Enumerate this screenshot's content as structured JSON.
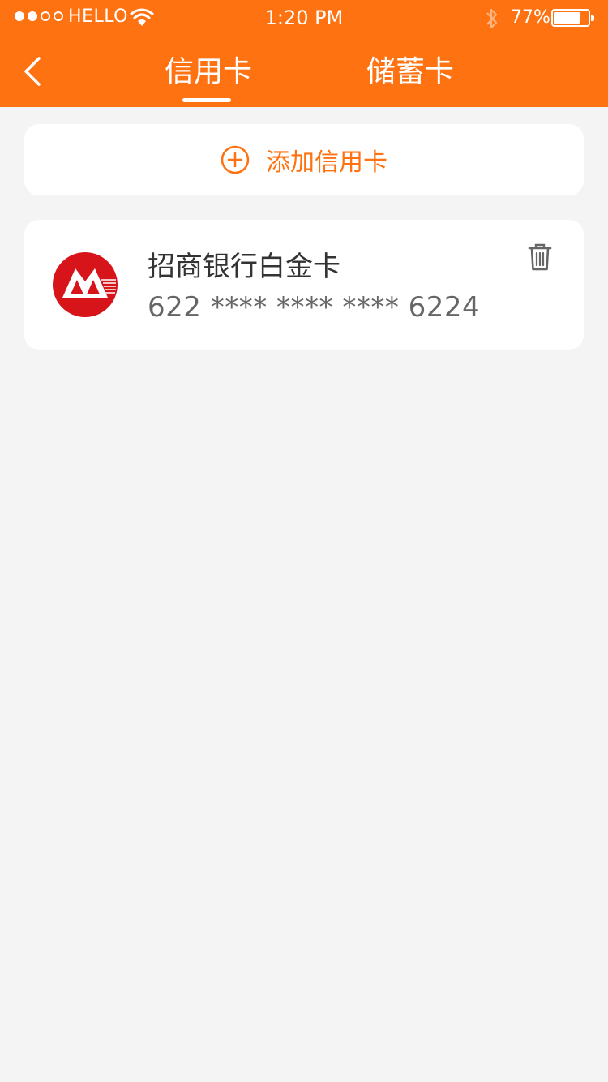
{
  "status_bar": {
    "carrier": "HELLO",
    "time": "1:20 PM",
    "battery_percent": "77%",
    "battery_level": 0.77,
    "signal_bars_filled": 2,
    "signal_bars_total": 5
  },
  "nav": {
    "back_icon": "chevron-left-icon",
    "tabs": [
      {
        "label": "信用卡",
        "active": true
      },
      {
        "label": "储蓄卡",
        "active": false
      }
    ]
  },
  "add_card": {
    "icon": "plus-circle-icon",
    "label": "添加信用卡"
  },
  "cards": [
    {
      "bank_logo": "cmb-logo",
      "name": "招商银行白金卡",
      "number": "622 **** **** **** 6224",
      "delete_icon": "trash-icon"
    }
  ],
  "colors": {
    "accent": "#ff7212",
    "background": "#f4f4f4",
    "card_bg": "#ffffff",
    "logo_red": "#d7141a"
  }
}
